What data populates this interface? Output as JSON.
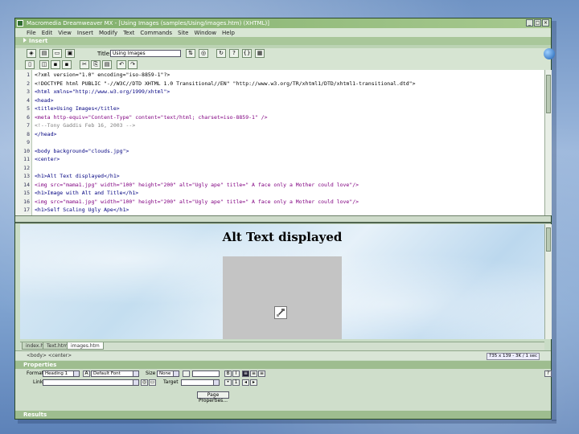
{
  "window": {
    "title": "Macromedia Dreamweaver MX - [Using Images (samples/Using/images.htm) (XHTML)]",
    "controls": [
      "_",
      "□",
      "×"
    ]
  },
  "menu": [
    "File",
    "Edit",
    "View",
    "Insert",
    "Modify",
    "Text",
    "Commands",
    "Site",
    "Window",
    "Help"
  ],
  "insert_panel": {
    "label": "Insert"
  },
  "document_toolbar": {
    "title_label": "Title:",
    "title_value": "Using Images"
  },
  "code_lines": [
    {
      "n": "1",
      "text": "<?xml version=\"1.0\" encoding=\"iso-8859-1\"?>",
      "color": "#000000"
    },
    {
      "n": "2",
      "text": "<!DOCTYPE html PUBLIC \"-//W3C//DTD XHTML 1.0 Transitional//EN\" \"http://www.w3.org/TR/xhtml1/DTD/xhtml1-transitional.dtd\">",
      "color": "#000000"
    },
    {
      "n": "3",
      "text": "<html xmlns=\"http://www.w3.org/1999/xhtml\">",
      "color": "#000080"
    },
    {
      "n": "4",
      "text": "<head>",
      "color": "#000080"
    },
    {
      "n": "5",
      "text": "<title>Using Images</title>",
      "color": "#000080"
    },
    {
      "n": "6",
      "text": "<meta http-equiv=\"Content-Type\" content=\"text/html; charset=iso-8859-1\" />",
      "color": "#800080"
    },
    {
      "n": "7",
      "text": "<!--Tony Gaddis Feb 16, 2003 -->",
      "color": "#808080"
    },
    {
      "n": "8",
      "text": "</head>",
      "color": "#000080"
    },
    {
      "n": "9",
      "text": "",
      "color": "#000000"
    },
    {
      "n": "10",
      "text": "<body background=\"clouds.jpg\">",
      "color": "#000080"
    },
    {
      "n": "11",
      "text": "<center>",
      "color": "#000080"
    },
    {
      "n": "12",
      "text": "",
      "color": "#000000"
    },
    {
      "n": "13",
      "text": "<h1>Alt Text displayed</h1>",
      "color": "#000080"
    },
    {
      "n": "14",
      "text": "<img src=\"mama1.jpg\" width=\"100\" height=\"200\" alt=\"Ugly ape\" title=\" A face only a Mother could love\"/>",
      "color": "#800080"
    },
    {
      "n": "15",
      "text": "<h1>Image with Alt and Title</h1>",
      "color": "#000080"
    },
    {
      "n": "16",
      "text": "<img src=\"mama1.jpg\" width=\"100\" height=\"200\" alt=\"Ugly ape\" title=\" A face only a Mother could love\"/>",
      "color": "#800080"
    },
    {
      "n": "17",
      "text": "<h1>Self Scaling Ugly Ape</h1>",
      "color": "#000080"
    }
  ],
  "design_view": {
    "heading": "Alt Text displayed"
  },
  "doc_tabs": [
    "index.htm",
    "Text.htm",
    "images.htm"
  ],
  "status": {
    "tag": "<body> <center>",
    "right": "735 x 139 - 3K / 1 sec"
  },
  "properties_panel": {
    "label": "Properties",
    "format_label": "Format",
    "format_value": "Heading 1",
    "font_value": "Default Font",
    "size_label": "Size",
    "size_value": "None",
    "link_label": "Link",
    "target_label": "Target",
    "page_button": "Page Properties..."
  },
  "results_panel": {
    "label": "Results"
  },
  "colors": {
    "accent": "#a9c79a",
    "window_bg": "#c9dcc6",
    "slide_bg": "#7fa3d0"
  }
}
